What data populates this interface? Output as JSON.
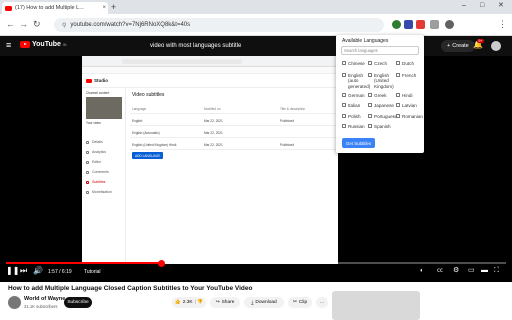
{
  "browser": {
    "tab_title": "(17) How to add Multiple L...",
    "tab_close": "×",
    "new_tab": "+",
    "url": "youtube.com/watch?v=7Nj6RNoXQ8k&t=40s",
    "minimize": "–",
    "maximize": "□",
    "close": "✕"
  },
  "youtube": {
    "logo_text": "YouTube",
    "logo_sup": "IN",
    "search_text": "video with most languages subtitle",
    "create_label": "Create",
    "notif_count": "9+"
  },
  "studio": {
    "brand": "Studio",
    "channel_label": "Your video",
    "section_title": "Video subtitles",
    "sidebar": [
      "Details",
      "Analytics",
      "Editor",
      "Comments",
      "Subtitles",
      "Monetisation"
    ],
    "table_header": [
      "Language",
      "Modified on",
      "Title & description"
    ],
    "rows": [
      [
        "English",
        "Mar 22, 2021",
        "Published"
      ],
      [
        "English (Automatic)",
        "Mar 22, 2021",
        ""
      ],
      [
        "English (United Kingdom) Hindi",
        "Mar 22, 2021",
        "Published"
      ]
    ],
    "add_language_label": "ADD LANGUAGE"
  },
  "lang_panel": {
    "title": "Available Languages",
    "search_placeholder": "Search languages",
    "languages": [
      [
        "Chinese",
        "Czech",
        "Dutch"
      ],
      [
        "English (auto generated)",
        "English (United Kingdom)",
        "French"
      ],
      [
        "German",
        "Greek",
        "Hindi"
      ],
      [
        "Italian",
        "Japanese",
        "Latvian"
      ],
      [
        "Polish",
        "Portuguese",
        "Romanian"
      ],
      [
        "Russian",
        "Spanish",
        ""
      ]
    ],
    "button": "Get Subtitles"
  },
  "player": {
    "time": "1:57 / 6:19",
    "chapter": "Tutorial",
    "progress": 0.31
  },
  "video": {
    "title": "How to add Multiple Language Closed Caption Subtitles to Your YouTube Video",
    "channel": "World of Wayne",
    "subscribers": "31.1K subscribers",
    "subscribe_label": "Subscribe",
    "likes": "2.3K",
    "share_label": "Share",
    "download_label": "Download",
    "clip_label": "Clip",
    "more_label": "..."
  },
  "colors": {
    "accent": "#ff0000",
    "panel_button": "#3b82f6"
  }
}
